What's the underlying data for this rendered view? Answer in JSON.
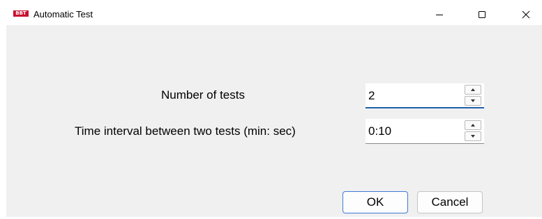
{
  "window": {
    "title": "Automatic Test",
    "app_icon_text": "BBT",
    "controls": {
      "minimize": "minimize-icon",
      "maximize": "maximize-icon",
      "close": "close-icon"
    }
  },
  "form": {
    "count_label": "Number of tests",
    "count_value": "2",
    "interval_label": "Time interval between two tests (min: sec)",
    "interval_value": "0:10"
  },
  "buttons": {
    "ok_label": "OK",
    "cancel_label": "Cancel"
  },
  "colors": {
    "accent": "#1f5fa8",
    "ok_border": "#3d7ad6",
    "dialog_bg": "#f0f0f0",
    "app_icon": "#c8102e"
  }
}
